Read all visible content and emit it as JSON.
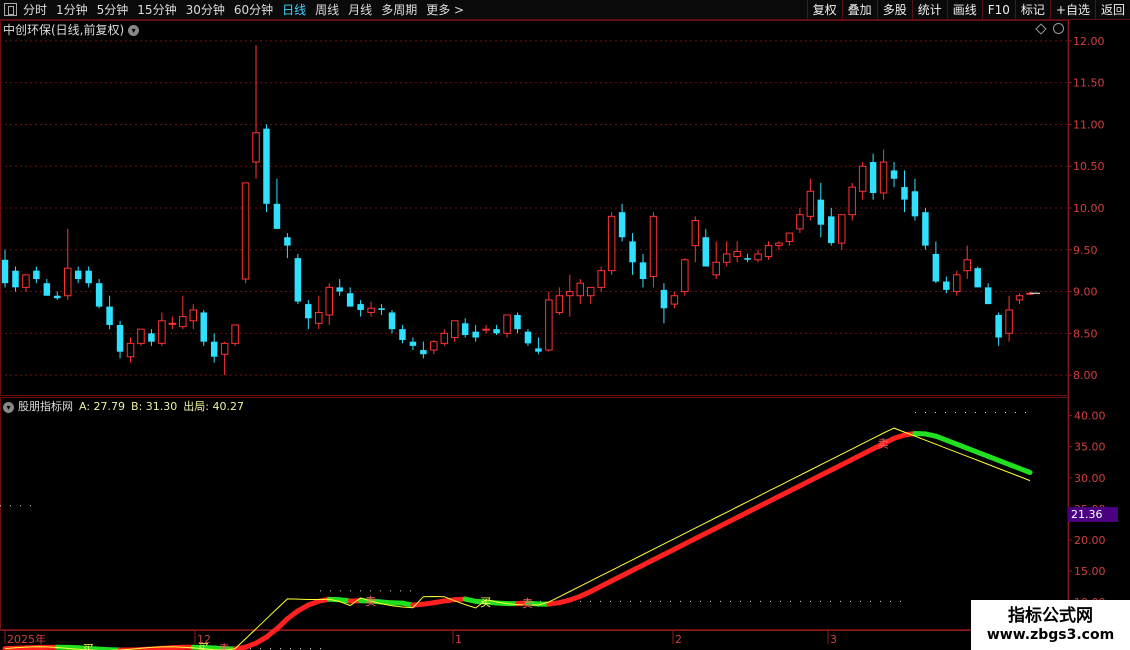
{
  "topbar": {
    "periods": [
      "分时",
      "1分钟",
      "5分钟",
      "15分钟",
      "30分钟",
      "60分钟",
      "日线",
      "周线",
      "月线",
      "多周期",
      "更多 >"
    ],
    "active_period": "日线",
    "right_buttons": [
      "复权",
      "叠加",
      "多股",
      "统计",
      "画线",
      "F10",
      "标记",
      "+自选",
      "返回"
    ]
  },
  "price_panel": {
    "title": "中创环保(日线,前复权)",
    "y_ticks": [
      "12.00",
      "11.50",
      "11.00",
      "10.50",
      "10.00",
      "9.50",
      "9.00",
      "8.50",
      "8.00"
    ],
    "y_range": [
      7.75,
      12.25
    ],
    "candle_colors": {
      "up": "#ff3333",
      "down": "#30e0ff"
    },
    "candles": [
      [
        9.38,
        9.5,
        9.05,
        9.1
      ],
      [
        9.25,
        9.3,
        9.0,
        9.05
      ],
      [
        9.05,
        9.2,
        9.0,
        9.2
      ],
      [
        9.25,
        9.3,
        9.1,
        9.15
      ],
      [
        9.1,
        9.15,
        8.95,
        8.95
      ],
      [
        8.95,
        9.0,
        8.9,
        8.92
      ],
      [
        8.95,
        9.75,
        8.9,
        9.28
      ],
      [
        9.25,
        9.3,
        9.1,
        9.15
      ],
      [
        9.25,
        9.3,
        9.05,
        9.1
      ],
      [
        9.1,
        9.15,
        8.8,
        8.82
      ],
      [
        8.82,
        8.95,
        8.55,
        8.6
      ],
      [
        8.6,
        8.65,
        8.2,
        8.28
      ],
      [
        8.22,
        8.45,
        8.15,
        8.38
      ],
      [
        8.38,
        8.55,
        8.35,
        8.55
      ],
      [
        8.5,
        8.55,
        8.35,
        8.4
      ],
      [
        8.38,
        8.75,
        8.35,
        8.65
      ],
      [
        8.62,
        8.7,
        8.55,
        8.62
      ],
      [
        8.58,
        8.95,
        8.55,
        8.7
      ],
      [
        8.65,
        8.85,
        8.55,
        8.78
      ],
      [
        8.75,
        8.78,
        8.35,
        8.4
      ],
      [
        8.4,
        8.5,
        8.15,
        8.22
      ],
      [
        8.25,
        8.4,
        8.0,
        8.38
      ],
      [
        8.38,
        8.6,
        8.35,
        8.6
      ],
      [
        9.15,
        10.3,
        9.1,
        10.3
      ],
      [
        10.55,
        11.95,
        10.35,
        10.9
      ],
      [
        10.95,
        11.0,
        9.95,
        10.05
      ],
      [
        10.05,
        10.35,
        9.75,
        9.75
      ],
      [
        9.65,
        9.7,
        9.4,
        9.55
      ],
      [
        9.4,
        9.45,
        8.85,
        8.88
      ],
      [
        8.85,
        8.9,
        8.55,
        8.68
      ],
      [
        8.62,
        8.95,
        8.55,
        8.75
      ],
      [
        8.72,
        9.1,
        8.6,
        9.05
      ],
      [
        9.05,
        9.15,
        8.95,
        9.0
      ],
      [
        8.98,
        9.05,
        8.85,
        8.82
      ],
      [
        8.85,
        8.9,
        8.7,
        8.78
      ],
      [
        8.75,
        8.88,
        8.7,
        8.8
      ],
      [
        8.8,
        8.85,
        8.72,
        8.78
      ],
      [
        8.75,
        8.78,
        8.5,
        8.55
      ],
      [
        8.55,
        8.6,
        8.38,
        8.42
      ],
      [
        8.4,
        8.45,
        8.3,
        8.35
      ],
      [
        8.3,
        8.4,
        8.2,
        8.25
      ],
      [
        8.3,
        8.42,
        8.25,
        8.4
      ],
      [
        8.38,
        8.55,
        8.35,
        8.5
      ],
      [
        8.45,
        8.65,
        8.4,
        8.65
      ],
      [
        8.62,
        8.68,
        8.45,
        8.48
      ],
      [
        8.52,
        8.6,
        8.4,
        8.45
      ],
      [
        8.55,
        8.6,
        8.5,
        8.55
      ],
      [
        8.55,
        8.6,
        8.48,
        8.5
      ],
      [
        8.5,
        8.72,
        8.45,
        8.72
      ],
      [
        8.72,
        8.75,
        8.5,
        8.55
      ],
      [
        8.52,
        8.55,
        8.35,
        8.38
      ],
      [
        8.32,
        8.45,
        8.25,
        8.28
      ],
      [
        8.3,
        9.0,
        8.28,
        8.9
      ],
      [
        8.75,
        9.05,
        8.72,
        8.95
      ],
      [
        8.95,
        9.2,
        8.7,
        9.0
      ],
      [
        8.95,
        9.15,
        8.85,
        9.1
      ],
      [
        8.95,
        9.05,
        8.85,
        9.05
      ],
      [
        9.05,
        9.3,
        9.0,
        9.25
      ],
      [
        9.25,
        9.95,
        9.2,
        9.9
      ],
      [
        9.95,
        10.05,
        9.6,
        9.65
      ],
      [
        9.6,
        9.7,
        9.2,
        9.35
      ],
      [
        9.35,
        9.45,
        9.05,
        9.15
      ],
      [
        9.18,
        9.95,
        9.05,
        9.9
      ],
      [
        9.02,
        9.1,
        8.62,
        8.8
      ],
      [
        8.85,
        9.0,
        8.8,
        8.95
      ],
      [
        9.0,
        9.4,
        8.95,
        9.38
      ],
      [
        9.55,
        9.9,
        9.35,
        9.85
      ],
      [
        9.65,
        9.75,
        9.3,
        9.3
      ],
      [
        9.2,
        9.6,
        9.15,
        9.35
      ],
      [
        9.35,
        9.6,
        9.3,
        9.45
      ],
      [
        9.42,
        9.6,
        9.35,
        9.48
      ],
      [
        9.4,
        9.45,
        9.35,
        9.38
      ],
      [
        9.38,
        9.5,
        9.35,
        9.45
      ],
      [
        9.42,
        9.6,
        9.38,
        9.55
      ],
      [
        9.55,
        9.6,
        9.5,
        9.58
      ],
      [
        9.6,
        9.7,
        9.55,
        9.7
      ],
      [
        9.75,
        10.0,
        9.7,
        9.92
      ],
      [
        9.9,
        10.35,
        9.85,
        10.2
      ],
      [
        10.1,
        10.3,
        9.65,
        9.8
      ],
      [
        9.9,
        10.0,
        9.55,
        9.58
      ],
      [
        9.58,
        9.9,
        9.5,
        9.92
      ],
      [
        9.92,
        10.3,
        9.85,
        10.25
      ],
      [
        10.2,
        10.55,
        10.1,
        10.5
      ],
      [
        10.55,
        10.65,
        10.1,
        10.18
      ],
      [
        10.18,
        10.7,
        10.1,
        10.55
      ],
      [
        10.45,
        10.55,
        10.25,
        10.35
      ],
      [
        10.25,
        10.45,
        9.95,
        10.1
      ],
      [
        10.2,
        10.35,
        9.85,
        9.9
      ],
      [
        9.95,
        10.0,
        9.5,
        9.55
      ],
      [
        9.45,
        9.6,
        9.1,
        9.12
      ],
      [
        9.12,
        9.18,
        8.98,
        9.02
      ],
      [
        9.0,
        9.25,
        8.95,
        9.2
      ],
      [
        9.25,
        9.55,
        9.15,
        9.38
      ],
      [
        9.28,
        9.3,
        9.05,
        9.05
      ],
      [
        9.05,
        9.1,
        8.85,
        8.85
      ],
      [
        8.72,
        8.75,
        8.35,
        8.45
      ],
      [
        8.5,
        8.95,
        8.4,
        8.78
      ],
      [
        8.9,
        8.98,
        8.85,
        8.95
      ],
      [
        8.98,
        9.0,
        8.96,
        8.98
      ]
    ]
  },
  "indicator_panel": {
    "name": "股朋指标网",
    "a_label": "A: 27.79",
    "b_label": "B: 31.30",
    "out_label": "出局: 40.27",
    "y_ticks": [
      "40.00",
      "35.00",
      "30.00",
      "25.00",
      "20.00",
      "15.00",
      "10.00"
    ],
    "y_range": [
      5.5,
      43
    ],
    "current_tag": "21.36",
    "x_labels": [
      "2025年",
      "12",
      "1",
      "2",
      "3"
    ],
    "signal_labels": [
      "买",
      "卖"
    ],
    "line_colors": {
      "A": "#ffff33",
      "B_up": "#ff2020",
      "B_down": "#20e020"
    }
  },
  "watermark": {
    "line1": "指标公式网",
    "line2": "www.zbgs3.com"
  }
}
